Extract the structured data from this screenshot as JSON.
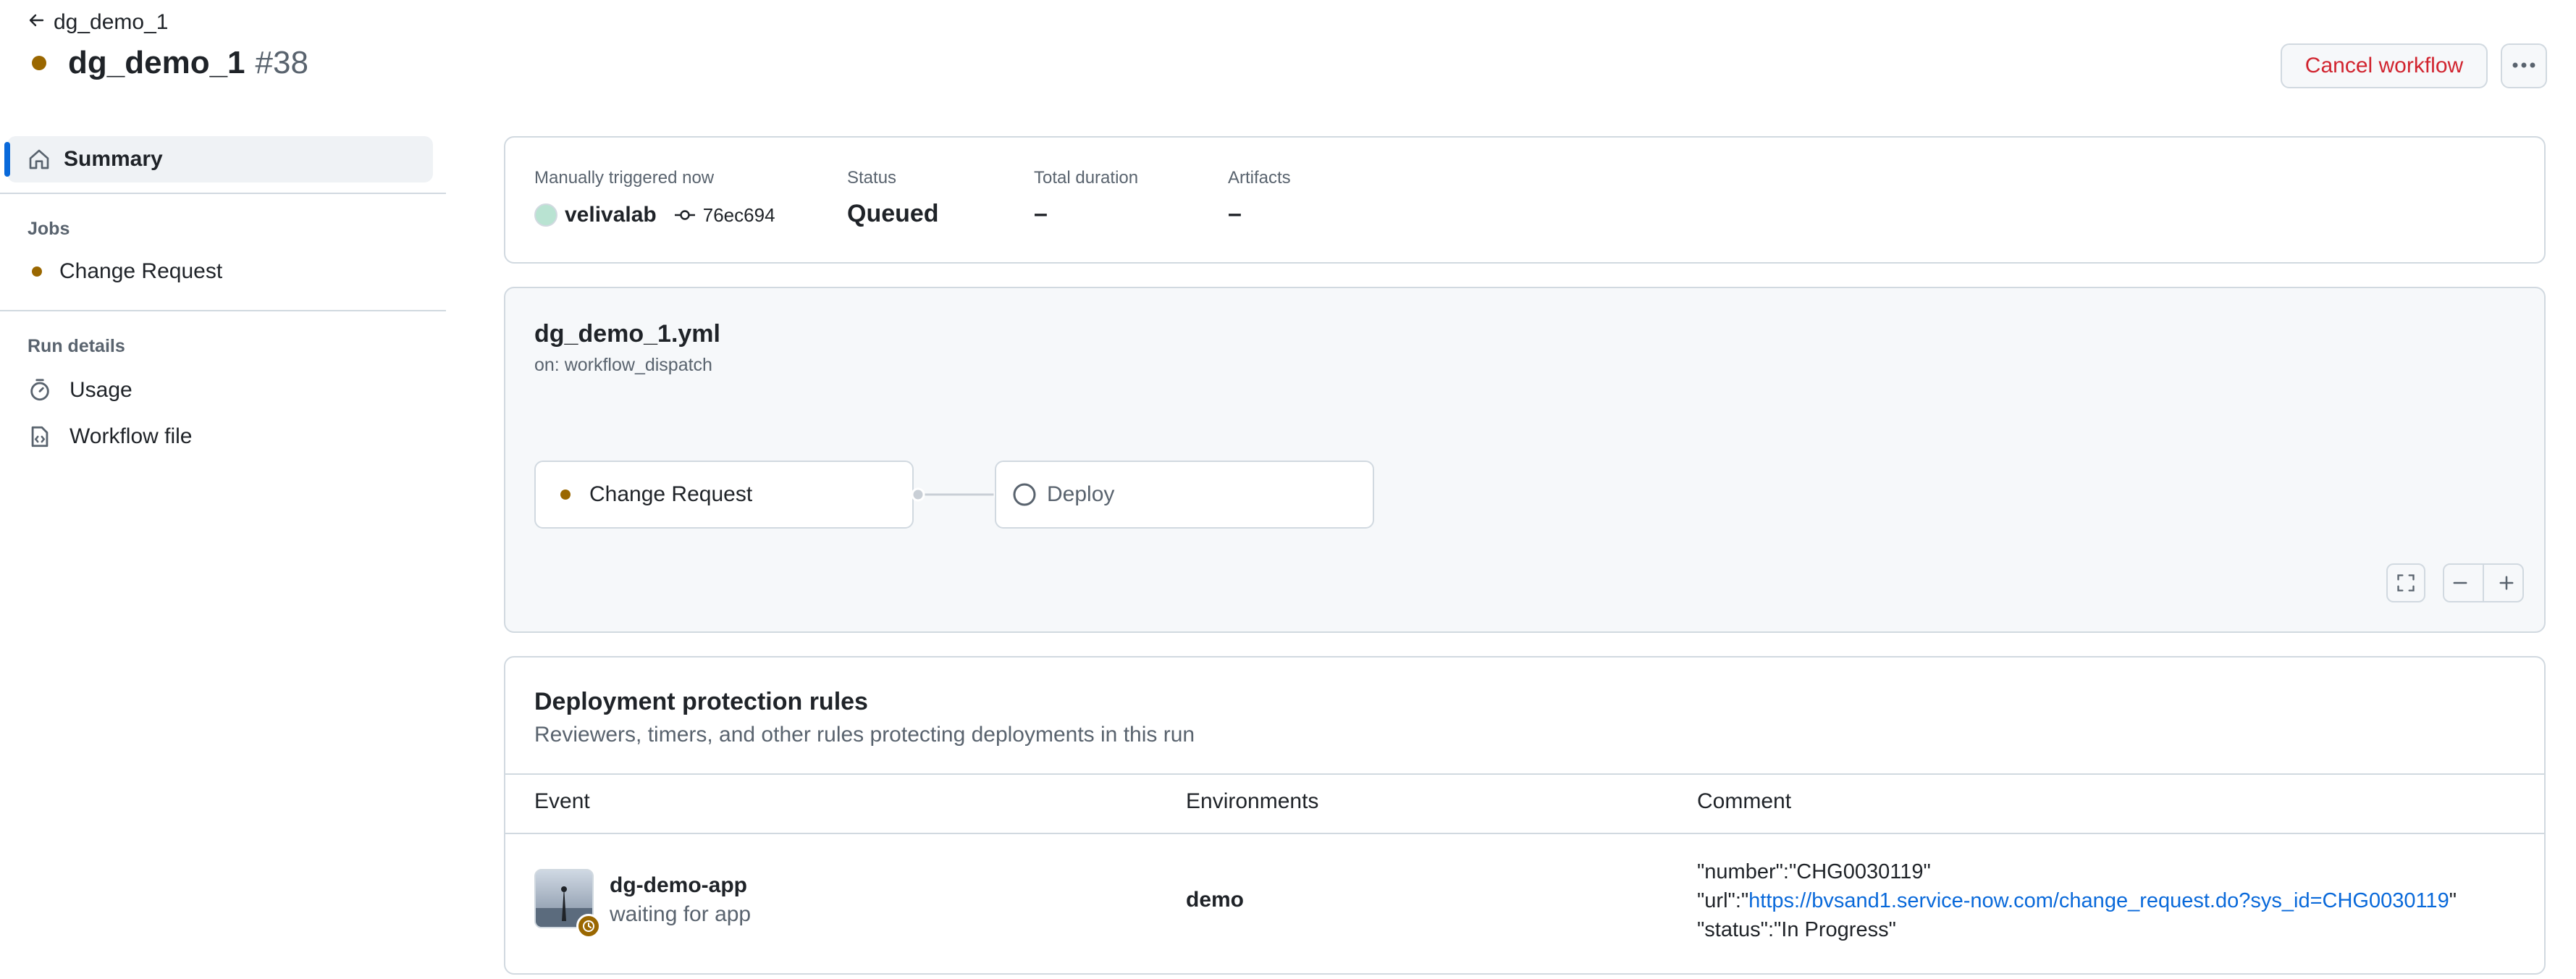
{
  "header": {
    "back_label": "dg_demo_1",
    "run_name": "dg_demo_1",
    "run_number": "#38",
    "cancel_label": "Cancel workflow",
    "more_label": "More actions",
    "status_color": "#9a6700"
  },
  "sidebar": {
    "summary_label": "Summary",
    "jobs_heading": "Jobs",
    "jobs": [
      {
        "label": "Change Request"
      }
    ],
    "run_details_heading": "Run details",
    "details": [
      {
        "label": "Usage"
      },
      {
        "label": "Workflow file"
      }
    ]
  },
  "summary": {
    "trigger_label": "Manually triggered now",
    "actor": "velivalab",
    "commit": "76ec694",
    "status_label": "Status",
    "status_value": "Queued",
    "duration_label": "Total duration",
    "duration_value": "–",
    "artifacts_label": "Artifacts",
    "artifacts_value": "–"
  },
  "workflow": {
    "file": "dg_demo_1.yml",
    "trigger": "on: workflow_dispatch",
    "jobs": [
      {
        "label": "Change Request",
        "state": "queued"
      },
      {
        "label": "Deploy",
        "state": "pending"
      }
    ]
  },
  "rules": {
    "title": "Deployment protection rules",
    "subtitle": "Reviewers, timers, and other rules protecting deployments in this run",
    "columns": {
      "event": "Event",
      "environments": "Environments",
      "comment": "Comment"
    },
    "row": {
      "app_name": "dg-demo-app",
      "app_status": "waiting for app",
      "environment": "demo",
      "comment_number": "\"number\":\"CHG0030119\"",
      "comment_url_prefix": "\"url\":\"",
      "comment_url": "https://bvsand1.service-now.com/change_request.do?sys_id=CHG0030119",
      "comment_url_suffix": "\"",
      "comment_status": "\"status\":\"In Progress\""
    }
  }
}
